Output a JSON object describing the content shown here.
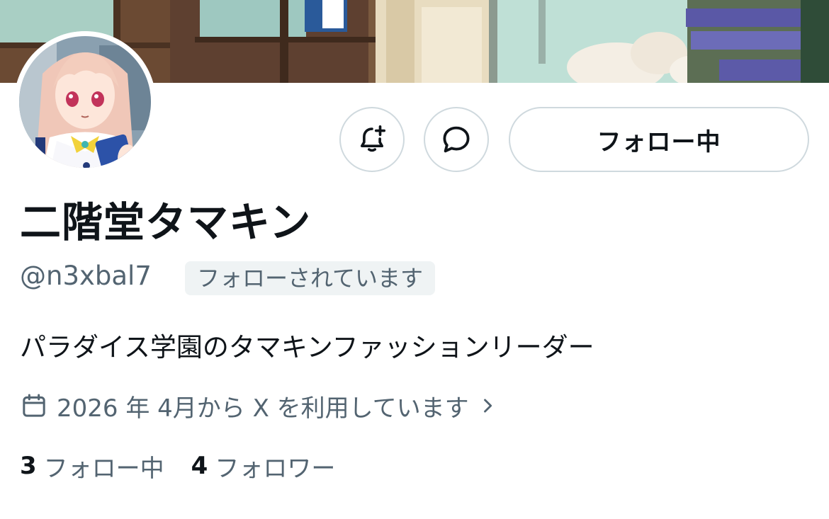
{
  "profile": {
    "display_name": "二階堂タマキン",
    "handle": "@n3xbal7",
    "follows_you_badge": "フォローされています",
    "bio": "パラダイス学園のタマキンファッションリーダー",
    "joined": "2026 年 4月から X を利用しています"
  },
  "actions": {
    "notify_icon": "bell-plus-icon",
    "message_icon": "message-bubble-icon",
    "follow_label": "フォロー中"
  },
  "stats": {
    "following_count": "3",
    "following_label": "フォロー中",
    "followers_count": "4",
    "followers_label": "フォロワー"
  },
  "colors": {
    "text_primary": "#0f1419",
    "text_secondary": "#536471",
    "border": "#cfd9de",
    "badge_bg": "#eff3f4"
  }
}
